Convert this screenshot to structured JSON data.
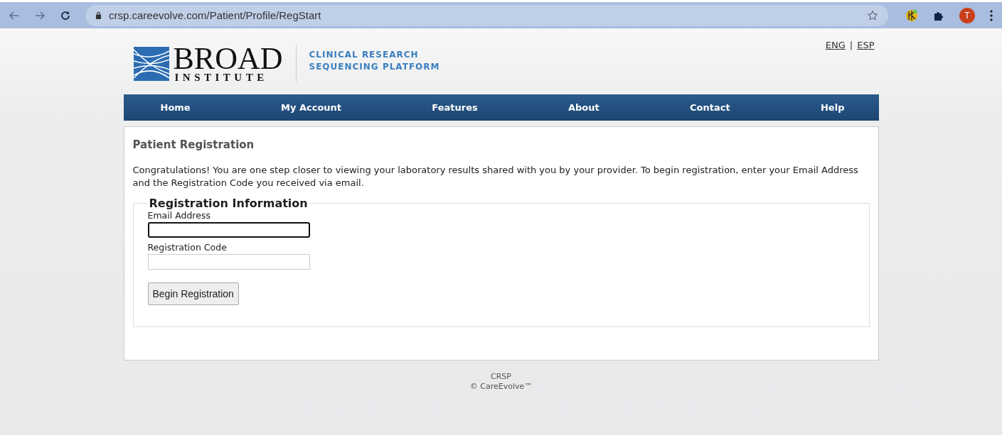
{
  "browser": {
    "url": "crsp.careevolve.com/Patient/Profile/RegStart",
    "avatar": "T"
  },
  "header": {
    "logo_main": "BROAD",
    "logo_sub": "INSTITUTE",
    "tagline": [
      "CLINICAL RESEARCH",
      "SEQUENCING PLATFORM"
    ],
    "languages": [
      "ENG",
      "ESP"
    ],
    "separator": "|"
  },
  "nav": [
    "Home",
    "My Account",
    "Features",
    "About",
    "Contact",
    "Help"
  ],
  "panel": {
    "title": "Patient Registration",
    "intro": "Congratulations! You are one step closer to viewing your laboratory results shared with you by your provider. To begin registration, enter your Email Address and the Registration Code you received via email.",
    "legend": "Registration Information",
    "fields": [
      {
        "label": "Email Address",
        "focused": true
      },
      {
        "label": "Registration Code",
        "focused": false
      }
    ],
    "button": "Begin Registration"
  },
  "footer": [
    "CRSP",
    "© CareEvolve™"
  ]
}
